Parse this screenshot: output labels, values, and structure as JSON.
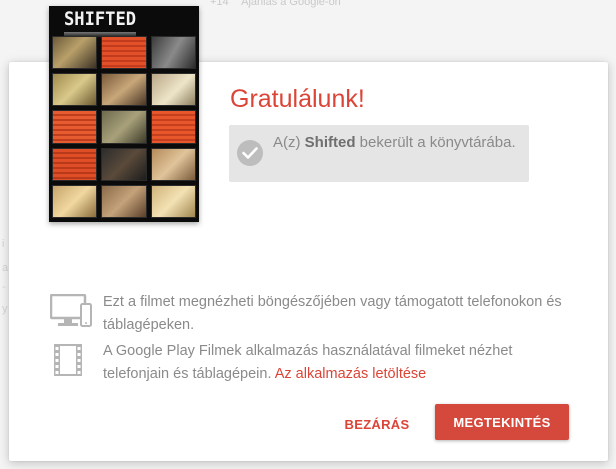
{
  "background": {
    "share_hint_plus": "+14",
    "share_hint_text": "Ajánlás a Google-on",
    "edge_marks": [
      "i",
      "a",
      "-",
      "y"
    ]
  },
  "dialog": {
    "poster_title": "SHIFTED",
    "congrats_title": "Gratulálunk!",
    "added_prefix": "A(z) ",
    "added_movie": "Shifted",
    "added_suffix": " bekerült a könyvtárába.",
    "info_browser": "Ezt a filmet megnézheti böngészőjében vagy támogatott telefonokon és táblagépeken.",
    "info_app": "A Google Play Filmek alkalmazás használatával filmeket nézhet telefonjain és táblagépein.",
    "app_link": "Az alkalmazás letöltése",
    "close_button": "BEZÁRÁS",
    "view_button": "MEGTEKINTÉS"
  },
  "icons": {
    "check": "check-circle-icon",
    "devices": "devices-icon",
    "film": "film-strip-icon"
  },
  "colors": {
    "accent": "#db4437",
    "button": "#d5483c",
    "text_muted": "#8a8a8a",
    "info_box": "#e5e5e5"
  }
}
